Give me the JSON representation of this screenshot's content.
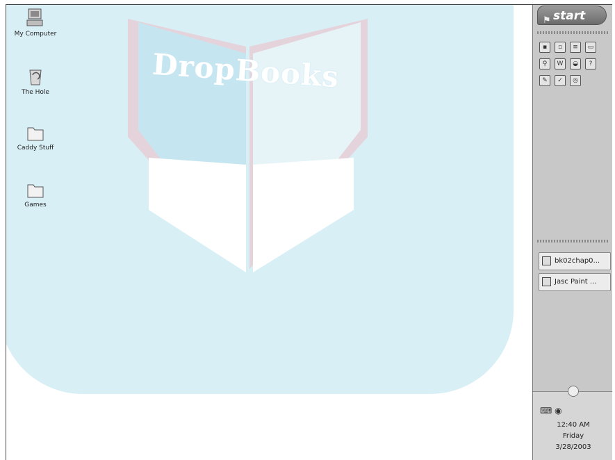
{
  "desktop": {
    "watermark_text": "DropBooks",
    "icons": [
      {
        "label": "My Computer",
        "icon": "computer-icon"
      },
      {
        "label": "The Hole",
        "icon": "recycle-bin-icon"
      },
      {
        "label": "Caddy Stuff",
        "icon": "folder-icon"
      },
      {
        "label": "Games",
        "icon": "folder-icon"
      }
    ]
  },
  "taskbar": {
    "start_label": "start",
    "quick_launch": [
      "save-icon",
      "calendar-icon",
      "document-icon",
      "notepad-icon",
      "search-icon",
      "word-icon",
      "mouse-icon",
      "help-icon",
      "paint-icon",
      "tools-icon",
      "network-icon"
    ],
    "tasks": [
      {
        "label": "bk02chap0...",
        "icon": "document-icon"
      },
      {
        "label": "Jasc Paint ...",
        "icon": "paint-program-icon"
      }
    ],
    "tray": {
      "icons": [
        "keyboard-icon",
        "network-icon"
      ],
      "time": "12:40 AM",
      "day": "Friday",
      "date": "3/28/2003"
    }
  },
  "colors": {
    "watermark": "#d9eff6",
    "taskbar": "#c8c8c8"
  }
}
